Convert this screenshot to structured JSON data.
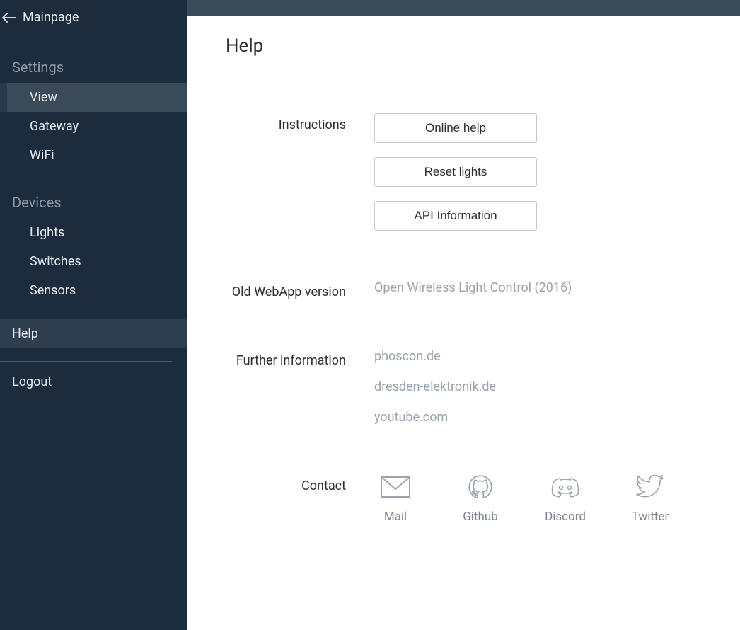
{
  "sidebar": {
    "back_label": "Mainpage",
    "sections": [
      {
        "header": "Settings",
        "items": [
          {
            "label": "View",
            "active": true
          },
          {
            "label": "Gateway",
            "active": false
          },
          {
            "label": "WiFi",
            "active": false
          }
        ]
      },
      {
        "header": "Devices",
        "items": [
          {
            "label": "Lights",
            "active": false
          },
          {
            "label": "Switches",
            "active": false
          },
          {
            "label": "Sensors",
            "active": false
          }
        ]
      }
    ],
    "help_label": "Help",
    "logout_label": "Logout"
  },
  "main": {
    "title": "Help",
    "instructions": {
      "label": "Instructions",
      "buttons": [
        "Online help",
        "Reset lights",
        "API Information"
      ]
    },
    "old_webapp": {
      "label": "Old WebApp version",
      "link": "Open Wireless Light Control (2016)"
    },
    "further_info": {
      "label": "Further information",
      "links": [
        "phoscon.de",
        "dresden-elektronik.de",
        "youtube.com"
      ]
    },
    "contact": {
      "label": "Contact",
      "items": [
        {
          "label": "Mail",
          "icon": "mail"
        },
        {
          "label": "Github",
          "icon": "github"
        },
        {
          "label": "Discord",
          "icon": "discord"
        },
        {
          "label": "Twitter",
          "icon": "twitter"
        }
      ]
    }
  }
}
